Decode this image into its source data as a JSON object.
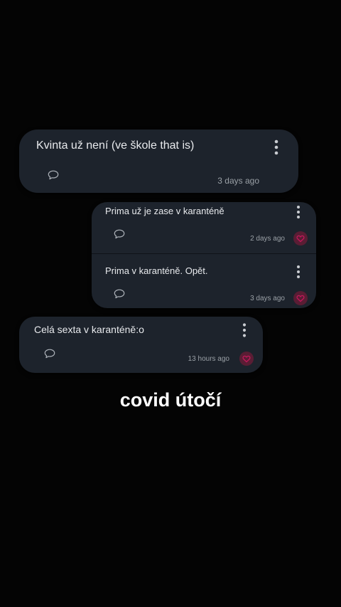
{
  "colors": {
    "background": "#040404",
    "card": "#1d232c",
    "text": "#e8eaed",
    "timestamp": "#9aa0a6",
    "reaction_accent": "#c2185b"
  },
  "icons": {
    "menu": "kebab-vertical-icon",
    "comment": "speech-bubble-icon",
    "reaction": "heart-icon"
  },
  "posts": [
    {
      "text": "Kvinta už není (ve škole that is)",
      "time": "3 days ago"
    },
    {
      "text": "Prima už je zase v karanténě",
      "time": "2 days ago"
    },
    {
      "text": "Prima v karanténě. Opět.",
      "time": "3 days ago"
    },
    {
      "text": "Celá sexta v karanténě:o",
      "time": "13 hours ago"
    }
  ],
  "caption": "covid útočí"
}
